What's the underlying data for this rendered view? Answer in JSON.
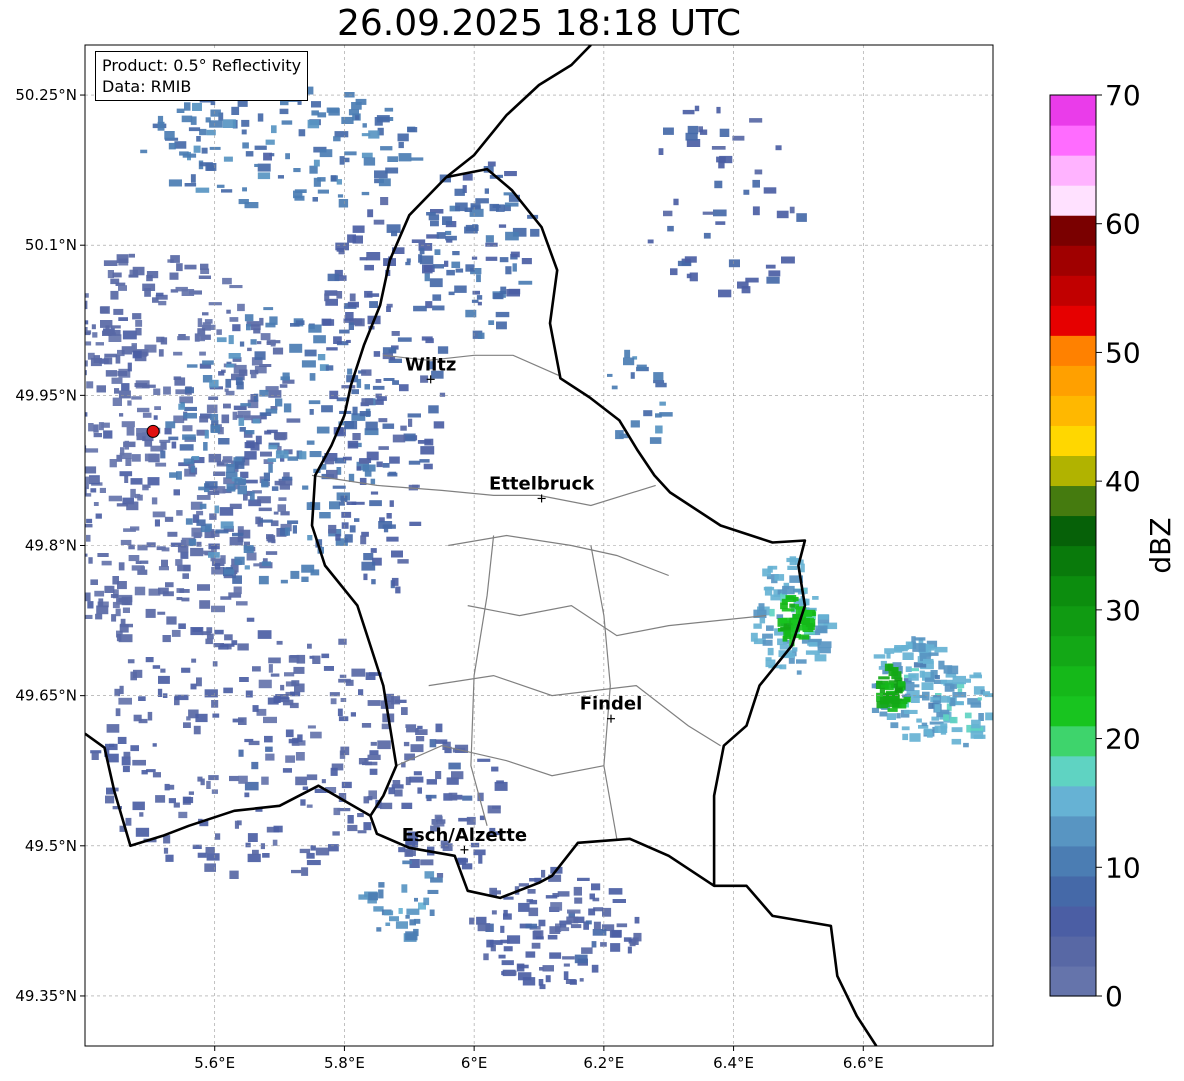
{
  "title": "26.09.2025 18:18 UTC",
  "info_box": {
    "product": "Product: 0.5° Reflectivity",
    "data": "Data: RMIB"
  },
  "map": {
    "lon_range": [
      5.4,
      6.8
    ],
    "lat_range": [
      49.3,
      50.3
    ],
    "x_ticks": [
      {
        "value": 5.6,
        "label": "5.6°E"
      },
      {
        "value": 5.8,
        "label": "5.8°E"
      },
      {
        "value": 6.0,
        "label": "6°E"
      },
      {
        "value": 6.2,
        "label": "6.2°E"
      },
      {
        "value": 6.4,
        "label": "6.4°E"
      },
      {
        "value": 6.6,
        "label": "6.6°E"
      }
    ],
    "y_ticks": [
      {
        "value": 50.25,
        "label": "50.25°N"
      },
      {
        "value": 50.1,
        "label": "50.1°N"
      },
      {
        "value": 49.95,
        "label": "49.95°N"
      },
      {
        "value": 49.8,
        "label": "49.8°N"
      },
      {
        "value": 49.65,
        "label": "49.65°N"
      },
      {
        "value": 49.5,
        "label": "49.5°N"
      },
      {
        "value": 49.35,
        "label": "49.35°N"
      }
    ],
    "grid": true,
    "radar_site": {
      "lon": 5.505,
      "lat": 49.914,
      "color": "#e01010"
    },
    "cities": [
      {
        "name": "Wiltz",
        "lon": 5.933,
        "lat": 49.966
      },
      {
        "name": "Ettelbruck",
        "lon": 6.104,
        "lat": 49.847
      },
      {
        "name": "Findel",
        "lon": 6.211,
        "lat": 49.627
      },
      {
        "name": "Esch/Alzette",
        "lon": 5.985,
        "lat": 49.496
      }
    ],
    "luxembourg_border": [
      [
        5.957,
        50.168
      ],
      [
        6.02,
        50.176
      ],
      [
        6.058,
        50.155
      ],
      [
        6.104,
        50.118
      ],
      [
        6.128,
        50.075
      ],
      [
        6.117,
        50.022
      ],
      [
        6.133,
        49.967
      ],
      [
        6.178,
        49.948
      ],
      [
        6.224,
        49.925
      ],
      [
        6.252,
        49.895
      ],
      [
        6.278,
        49.87
      ],
      [
        6.302,
        49.853
      ],
      [
        6.38,
        49.82
      ],
      [
        6.46,
        49.803
      ],
      [
        6.51,
        49.805
      ],
      [
        6.5,
        49.78
      ],
      [
        6.51,
        49.74
      ],
      [
        6.49,
        49.7
      ],
      [
        6.44,
        49.66
      ],
      [
        6.42,
        49.62
      ],
      [
        6.385,
        49.6
      ],
      [
        6.37,
        49.55
      ],
      [
        6.37,
        49.46
      ],
      [
        6.3,
        49.49
      ],
      [
        6.24,
        49.507
      ],
      [
        6.16,
        49.503
      ],
      [
        6.12,
        49.47
      ],
      [
        6.1,
        49.463
      ],
      [
        6.04,
        49.448
      ],
      [
        5.99,
        49.455
      ],
      [
        5.97,
        49.49
      ],
      [
        5.9,
        49.498
      ],
      [
        5.85,
        49.512
      ],
      [
        5.84,
        49.53
      ],
      [
        5.86,
        49.55
      ],
      [
        5.88,
        49.58
      ],
      [
        5.87,
        49.62
      ],
      [
        5.86,
        49.66
      ],
      [
        5.84,
        49.7
      ],
      [
        5.82,
        49.74
      ],
      [
        5.77,
        49.78
      ],
      [
        5.75,
        49.82
      ],
      [
        5.755,
        49.87
      ],
      [
        5.78,
        49.9
      ],
      [
        5.8,
        49.93
      ],
      [
        5.81,
        49.96
      ],
      [
        5.83,
        50.0
      ],
      [
        5.855,
        50.04
      ],
      [
        5.87,
        50.085
      ],
      [
        5.9,
        50.13
      ],
      [
        5.957,
        50.168
      ]
    ],
    "belgium_border_west": [
      [
        5.4,
        49.612
      ],
      [
        5.43,
        49.598
      ],
      [
        5.445,
        49.555
      ],
      [
        5.47,
        49.5
      ],
      [
        5.52,
        49.51
      ],
      [
        5.56,
        49.52
      ],
      [
        5.63,
        49.535
      ],
      [
        5.7,
        49.54
      ],
      [
        5.76,
        49.56
      ],
      [
        5.8,
        49.545
      ],
      [
        5.84,
        49.53
      ]
    ],
    "germany_border_east": [
      [
        6.37,
        49.46
      ],
      [
        6.42,
        49.46
      ],
      [
        6.46,
        49.43
      ],
      [
        6.55,
        49.42
      ],
      [
        6.56,
        49.37
      ],
      [
        6.59,
        49.33
      ],
      [
        6.62,
        49.3
      ]
    ],
    "germany_border_north": [
      [
        5.957,
        50.168
      ],
      [
        6.0,
        50.19
      ],
      [
        6.05,
        50.23
      ],
      [
        6.1,
        50.26
      ],
      [
        6.15,
        50.28
      ],
      [
        6.18,
        50.3
      ]
    ],
    "canton_lines": [
      [
        [
          5.86,
          49.99
        ],
        [
          5.93,
          49.985
        ],
        [
          6.0,
          49.99
        ],
        [
          6.06,
          49.99
        ],
        [
          6.13,
          49.97
        ]
      ],
      [
        [
          5.75,
          49.87
        ],
        [
          5.85,
          49.86
        ],
        [
          5.95,
          49.855
        ],
        [
          6.03,
          49.85
        ],
        [
          6.1,
          49.85
        ],
        [
          6.18,
          49.84
        ],
        [
          6.28,
          49.86
        ]
      ],
      [
        [
          5.96,
          49.8
        ],
        [
          6.05,
          49.81
        ],
        [
          6.15,
          49.8
        ],
        [
          6.22,
          49.79
        ],
        [
          6.3,
          49.77
        ]
      ],
      [
        [
          5.93,
          49.66
        ],
        [
          6.03,
          49.67
        ],
        [
          6.12,
          49.65
        ],
        [
          6.25,
          49.66
        ],
        [
          6.33,
          49.62
        ],
        [
          6.38,
          49.6
        ]
      ],
      [
        [
          5.99,
          49.74
        ],
        [
          6.07,
          49.73
        ],
        [
          6.15,
          49.74
        ],
        [
          6.22,
          49.71
        ],
        [
          6.3,
          49.72
        ],
        [
          6.45,
          49.73
        ]
      ],
      [
        [
          6.03,
          49.81
        ],
        [
          6.02,
          49.75
        ],
        [
          6.0,
          49.67
        ],
        [
          5.995,
          49.58
        ],
        [
          6.02,
          49.52
        ]
      ],
      [
        [
          6.18,
          49.8
        ],
        [
          6.2,
          49.73
        ],
        [
          6.21,
          49.66
        ],
        [
          6.2,
          49.58
        ],
        [
          6.22,
          49.507
        ]
      ],
      [
        [
          5.88,
          49.58
        ],
        [
          5.95,
          49.6
        ],
        [
          6.05,
          49.585
        ],
        [
          6.12,
          49.57
        ],
        [
          6.2,
          49.58
        ]
      ]
    ],
    "echo_clusters": [
      {
        "lon": 5.5,
        "lat": 49.9,
        "rx": 0.22,
        "ry": 0.2,
        "dbz": 3,
        "count": 520
      },
      {
        "lon": 5.68,
        "lat": 49.9,
        "rx": 0.17,
        "ry": 0.14,
        "dbz": 10,
        "count": 170
      },
      {
        "lon": 5.85,
        "lat": 49.95,
        "rx": 0.1,
        "ry": 0.2,
        "dbz": 6,
        "count": 160
      },
      {
        "lon": 5.7,
        "lat": 50.2,
        "rx": 0.22,
        "ry": 0.06,
        "dbz": 10,
        "count": 130
      },
      {
        "lon": 6.0,
        "lat": 50.1,
        "rx": 0.09,
        "ry": 0.09,
        "dbz": 8,
        "count": 90
      },
      {
        "lon": 5.65,
        "lat": 49.6,
        "rx": 0.25,
        "ry": 0.13,
        "dbz": 4,
        "count": 240
      },
      {
        "lon": 5.95,
        "lat": 49.55,
        "rx": 0.09,
        "ry": 0.08,
        "dbz": 5,
        "count": 70
      },
      {
        "lon": 6.12,
        "lat": 49.42,
        "rx": 0.13,
        "ry": 0.06,
        "dbz": 5,
        "count": 110
      },
      {
        "lon": 5.88,
        "lat": 49.45,
        "rx": 0.06,
        "ry": 0.04,
        "dbz": 12,
        "count": 30
      },
      {
        "lon": 6.48,
        "lat": 49.73,
        "rx": 0.06,
        "ry": 0.06,
        "dbz": 14,
        "count": 90
      },
      {
        "lon": 6.49,
        "lat": 49.73,
        "rx": 0.025,
        "ry": 0.025,
        "dbz": 24,
        "count": 40
      },
      {
        "lon": 6.67,
        "lat": 49.66,
        "rx": 0.07,
        "ry": 0.05,
        "dbz": 14,
        "count": 100
      },
      {
        "lon": 6.64,
        "lat": 49.66,
        "rx": 0.025,
        "ry": 0.025,
        "dbz": 26,
        "count": 40
      },
      {
        "lon": 6.75,
        "lat": 49.64,
        "rx": 0.04,
        "ry": 0.04,
        "dbz": 15,
        "count": 40
      },
      {
        "lon": 6.38,
        "lat": 50.15,
        "rx": 0.13,
        "ry": 0.1,
        "dbz": 6,
        "count": 50
      },
      {
        "lon": 6.25,
        "lat": 49.95,
        "rx": 0.05,
        "ry": 0.05,
        "dbz": 10,
        "count": 20
      }
    ]
  },
  "colorbar": {
    "label": "dBZ",
    "min": 0,
    "max": 70,
    "ticks": [
      0,
      10,
      20,
      30,
      40,
      50,
      60,
      70
    ],
    "colors": [
      "#6574ab",
      "#5868a5",
      "#4b5ea4",
      "#4569a8",
      "#4b7db3",
      "#5895c2",
      "#66b2d4",
      "#5fd3c2",
      "#3ed46c",
      "#18c41f",
      "#15b819",
      "#13a816",
      "#109b12",
      "#0c8d0e",
      "#097a0b",
      "#066108",
      "#457b0f",
      "#b1b300",
      "#ffd700",
      "#ffb800",
      "#ffa000",
      "#ff8100",
      "#e60000",
      "#c10000",
      "#a00000",
      "#7a0000",
      "#ffe1ff",
      "#ffb3ff",
      "#ff6cff",
      "#ea3cea"
    ]
  }
}
